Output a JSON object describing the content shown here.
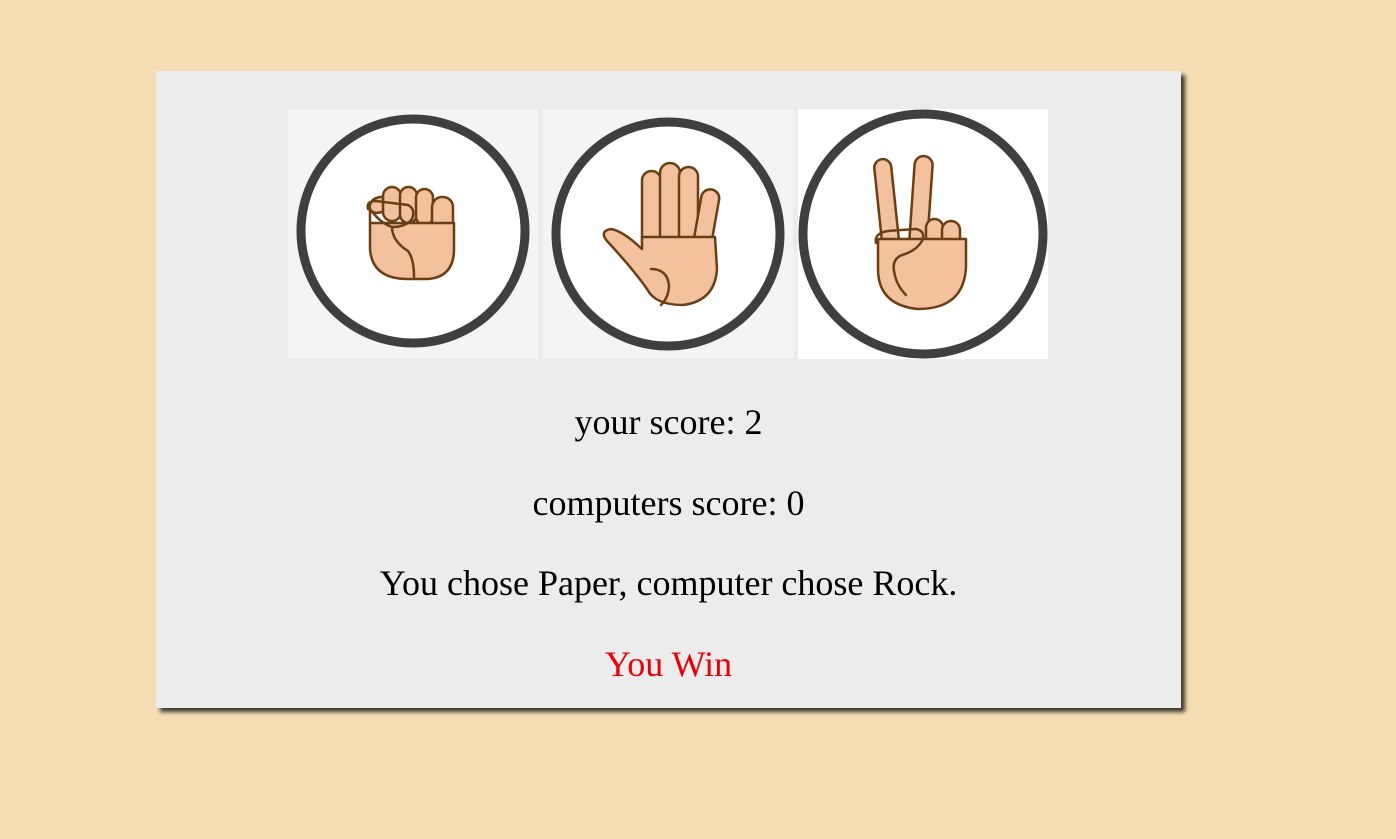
{
  "choices": [
    {
      "name": "Rock",
      "icon": "rock-fist-icon"
    },
    {
      "name": "Paper",
      "icon": "paper-hand-icon"
    },
    {
      "name": "Scissors",
      "icon": "scissors-peace-icon"
    }
  ],
  "score": {
    "user_label": "your score: 2",
    "computer_label": "computers score: 0"
  },
  "message": "You chose Paper, computer chose Rock.",
  "result": {
    "text": "You Win",
    "color": "#e8000b"
  },
  "colors": {
    "background": "#f5deb3",
    "card": "#ececec",
    "ring": "#3f3f3f",
    "skin": "#f3c19d",
    "outline": "#6b3f14"
  }
}
